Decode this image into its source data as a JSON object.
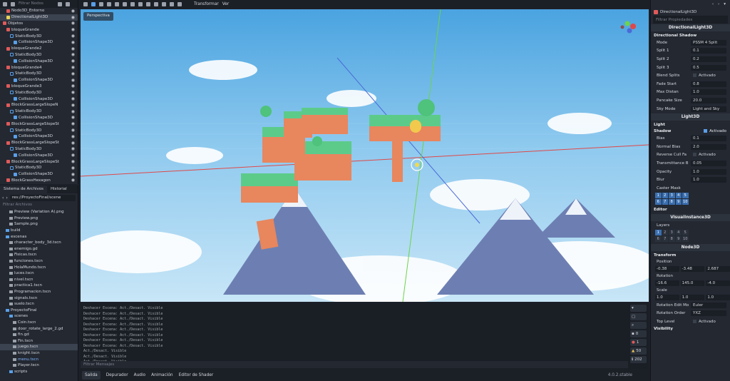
{
  "scene_panel": {
    "filter_placeholder": "Filtrar Nodos",
    "nodes": [
      {
        "label": "Nodo3D_Entorno",
        "indent": 1,
        "type": "n3d"
      },
      {
        "label": "DirectionalLight3D",
        "indent": 1,
        "type": "lt",
        "selected": true
      },
      {
        "label": "Objetos",
        "indent": 0,
        "type": "n3d"
      },
      {
        "label": "bloqueGrande",
        "indent": 1,
        "type": "n3d"
      },
      {
        "label": "StaticBody3D",
        "indent": 2,
        "type": "sb"
      },
      {
        "label": "CollisionShape3D",
        "indent": 3,
        "type": "cs"
      },
      {
        "label": "bloqueGrande2",
        "indent": 1,
        "type": "n3d"
      },
      {
        "label": "StaticBody3D",
        "indent": 2,
        "type": "sb"
      },
      {
        "label": "CollisionShape3D",
        "indent": 3,
        "type": "cs"
      },
      {
        "label": "bloqueGrande4",
        "indent": 1,
        "type": "n3d"
      },
      {
        "label": "StaticBody3D",
        "indent": 2,
        "type": "sb"
      },
      {
        "label": "CollisionShape3D",
        "indent": 3,
        "type": "cs"
      },
      {
        "label": "bloqueGrande3",
        "indent": 1,
        "type": "n3d"
      },
      {
        "label": "StaticBody3D",
        "indent": 2,
        "type": "sb"
      },
      {
        "label": "CollisionShape3D",
        "indent": 3,
        "type": "cs"
      },
      {
        "label": "BlockGrassLargeSlopeN",
        "indent": 1,
        "type": "n3d"
      },
      {
        "label": "StaticBody3D",
        "indent": 2,
        "type": "sb"
      },
      {
        "label": "CollisionShape3D",
        "indent": 3,
        "type": "cs"
      },
      {
        "label": "BlockGrassLargeSlopeSt",
        "indent": 1,
        "type": "n3d"
      },
      {
        "label": "StaticBody3D",
        "indent": 2,
        "type": "sb"
      },
      {
        "label": "CollisionShape3D",
        "indent": 3,
        "type": "cs"
      },
      {
        "label": "BlockGrassLargeSlopeSt",
        "indent": 1,
        "type": "n3d"
      },
      {
        "label": "StaticBody3D",
        "indent": 2,
        "type": "sb"
      },
      {
        "label": "CollisionShape3D",
        "indent": 3,
        "type": "cs"
      },
      {
        "label": "BlockGrassLargeSlopeSt",
        "indent": 1,
        "type": "n3d"
      },
      {
        "label": "StaticBody3D",
        "indent": 2,
        "type": "sb"
      },
      {
        "label": "CollisionShape3D",
        "indent": 3,
        "type": "cs"
      },
      {
        "label": "BlockGrassHexagon",
        "indent": 1,
        "type": "n3d"
      }
    ]
  },
  "filesystem": {
    "tabs": [
      "Sistema de Archivos",
      "Historial"
    ],
    "path": "res://ProyectoFinal/scene",
    "filter_placeholder": "Filtrar Archivos",
    "items": [
      {
        "label": "Preview (Variation A).png",
        "indent": 2,
        "dir": false
      },
      {
        "label": "Preview.png",
        "indent": 2,
        "dir": false
      },
      {
        "label": "Sample.png",
        "indent": 2,
        "dir": false
      },
      {
        "label": "build",
        "indent": 1,
        "dir": true
      },
      {
        "label": "escenas",
        "indent": 1,
        "dir": true
      },
      {
        "label": "character_body_3d.tscn",
        "indent": 2,
        "dir": false
      },
      {
        "label": "enemigo.gd",
        "indent": 2,
        "dir": false
      },
      {
        "label": "Fisicas.tscn",
        "indent": 2,
        "dir": false
      },
      {
        "label": "funciones.tscn",
        "indent": 2,
        "dir": false
      },
      {
        "label": "HolaMundo.tscn",
        "indent": 2,
        "dir": false
      },
      {
        "label": "luces.tscn",
        "indent": 2,
        "dir": false
      },
      {
        "label": "nivel.tscn",
        "indent": 2,
        "dir": false
      },
      {
        "label": "practica1.tscn",
        "indent": 2,
        "dir": false
      },
      {
        "label": "Programacion.tscn",
        "indent": 2,
        "dir": false
      },
      {
        "label": "signals.tscn",
        "indent": 2,
        "dir": false
      },
      {
        "label": "suelo.tscn",
        "indent": 2,
        "dir": false
      },
      {
        "label": "ProyectoFinal",
        "indent": 1,
        "dir": true
      },
      {
        "label": "scenes",
        "indent": 2,
        "dir": true
      },
      {
        "label": "Coin.tscn",
        "indent": 3,
        "dir": false
      },
      {
        "label": "door_rotate_large_2.gd",
        "indent": 3,
        "dir": false
      },
      {
        "label": "fin.gd",
        "indent": 3,
        "dir": false
      },
      {
        "label": "Fin.tscn",
        "indent": 3,
        "dir": false
      },
      {
        "label": "juego.tscn",
        "indent": 3,
        "dir": false,
        "selected": true
      },
      {
        "label": "knight.tscn",
        "indent": 3,
        "dir": false
      },
      {
        "label": "menu.tscn",
        "indent": 3,
        "dir": false,
        "blue": true
      },
      {
        "label": "Player.tscn",
        "indent": 3,
        "dir": false
      },
      {
        "label": "scripts",
        "indent": 2,
        "dir": true
      }
    ]
  },
  "toolbar": {
    "transform": "Transformar",
    "view": "Ver"
  },
  "viewport": {
    "perspective": "Perspectiva"
  },
  "output": {
    "lines": [
      "Deshacer Escena: Act./Desact. Visible",
      "Deshacer Escena: Act./Desact. Visible",
      "Deshacer Escena: Act./Desact. Visible",
      "Deshacer Escena: Act./Desact. Visible",
      "Deshacer Escena: Act./Desact. Visible",
      "Deshacer Escena: Act./Desact. Visible",
      "Deshacer Escena: Act./Desact. Visible",
      "Deshacer Escena: Act./Desact. Visible",
      "Act./Desact. Visible",
      "Act./Desact. Visible",
      "Act./Desact. Visible"
    ],
    "filter_placeholder": "Filtrar Mensajes",
    "counts": {
      "messages": "0",
      "errors": "1",
      "warnings": "50",
      "info": "202"
    }
  },
  "bottom_tabs": [
    "Salida",
    "Depurador",
    "Audio",
    "Animación",
    "Editor de Shader"
  ],
  "version": "4.0.2.stable",
  "inspector": {
    "node_name": "DirectionalLight3D",
    "filter_placeholder": "Filtrar Propiedades",
    "class_title": "DirectionalLight3D",
    "sections": {
      "directional_shadow": "Directional Shadow",
      "light3d": "Light3D",
      "light": "Light",
      "shadow": "Shadow",
      "editor": "Editor",
      "visual_instance": "VisualInstance3D",
      "layers": "Layers",
      "node3d": "Node3D",
      "transform": "Transform",
      "visibility": "Visibility"
    },
    "ds_props": [
      {
        "label": "Mode",
        "value": "PSSM 4 Split"
      },
      {
        "label": "Split 1",
        "value": "0.1"
      },
      {
        "label": "Split 2",
        "value": "0.2"
      },
      {
        "label": "Split 3",
        "value": "0.5"
      },
      {
        "label": "Blend Splits",
        "value": "Activado"
      },
      {
        "label": "Fade Start",
        "value": "0.8"
      },
      {
        "label": "Max Distan",
        "value": "1.0"
      },
      {
        "label": "Pancake Size",
        "value": "20.0"
      },
      {
        "label": "Sky Mode",
        "value": "Light and Sky"
      }
    ],
    "shadow_enabled": "Activado",
    "shadow_props": [
      {
        "label": "Bias",
        "value": "0.1"
      },
      {
        "label": "Normal Bias",
        "value": "2.0"
      },
      {
        "label": "Reverse Cull Fa",
        "value": "Activado"
      },
      {
        "label": "Transmittance B",
        "value": "0.05"
      },
      {
        "label": "Opacity",
        "value": "1.0"
      },
      {
        "label": "Blur",
        "value": "1.0"
      },
      {
        "label": "Caster Mask",
        "value": ""
      }
    ],
    "mask_bits": [
      "1",
      "2",
      "3",
      "4",
      "5",
      "6",
      "7",
      "8",
      "9",
      "10"
    ],
    "layer_bits": [
      "1",
      "2",
      "3",
      "4",
      "5",
      "6",
      "7",
      "8",
      "9",
      "10"
    ],
    "position": {
      "label": "Position",
      "x": "-0.38",
      "y": "-3.48",
      "z": "2.687"
    },
    "rotation": {
      "label": "Rotation",
      "x": "-16.6",
      "y": "145.0",
      "z": "-4.0"
    },
    "scale": {
      "label": "Scale",
      "x": "1.0",
      "y": "1.0",
      "z": "1.0"
    },
    "tail_props": [
      {
        "label": "Rotation Edit Mo",
        "value": "Euler"
      },
      {
        "label": "Rotation Order",
        "value": "YXZ"
      },
      {
        "label": "Top Level",
        "value": "Activado"
      }
    ]
  },
  "colors": {
    "accent": "#5a9fe8",
    "panel": "#232831",
    "sky": "#9fd4f2"
  }
}
